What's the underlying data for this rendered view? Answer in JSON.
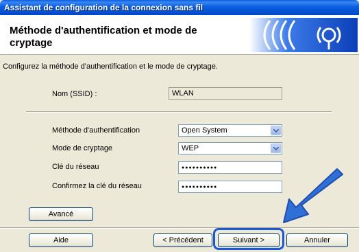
{
  "window": {
    "title": "Assistant de configuration de la connexion sans fil"
  },
  "header": {
    "heading": "Méthode d'authentification et mode de cryptage",
    "logo_icon": "wireless-signal-icon"
  },
  "instruction": "Configurez la méthode d'authentification et le mode de cryptage.",
  "ssid": {
    "label": "Nom (SSID) :",
    "value": "WLAN"
  },
  "auth": {
    "label": "Méthode d'authentification",
    "selected": "Open System"
  },
  "encryption": {
    "label": "Mode de cryptage",
    "selected": "WEP"
  },
  "network_key": {
    "label": "Clé du réseau",
    "value": "●●●●●●●●●●"
  },
  "confirm_key": {
    "label": "Confirmez la clé du réseau",
    "value": "●●●●●●●●●●"
  },
  "buttons": {
    "advanced": "Avancé",
    "help": "Aide",
    "previous": "< Précédent",
    "next": "Suivant >",
    "cancel": "Annuler"
  },
  "colors": {
    "titlebar": "#0a5fe0",
    "highlight": "#1c57d6",
    "pointer_arrow": "#2f6fd6"
  }
}
